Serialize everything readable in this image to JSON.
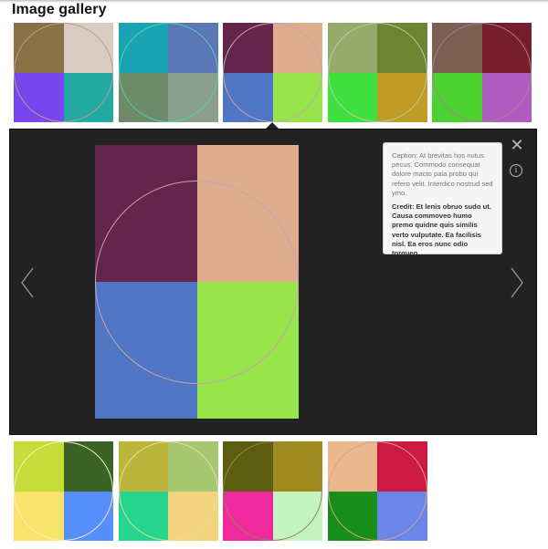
{
  "title": "Image gallery",
  "thumbnails_top": [
    {
      "q": [
        "#887245",
        "#d8cbc0",
        "#7747ee",
        "#22aaa0"
      ],
      "ring": "#c09a90"
    },
    {
      "q": [
        "#1ba3b5",
        "#5c77b5",
        "#6e8a6a",
        "#8ba08c"
      ],
      "ring": "#4fd6a4"
    },
    {
      "q": [
        "#64244b",
        "#ddad8e",
        "#5076c3",
        "#98e54b"
      ],
      "ring": "#c7a4b0"
    },
    {
      "q": [
        "#96aa6b",
        "#6c8530",
        "#3ee03d",
        "#bf9c26"
      ],
      "ring": "#bcc9a8"
    },
    {
      "q": [
        "#7c5e52",
        "#771e2c",
        "#4dd031",
        "#b05cbe"
      ],
      "ring": "#a08490"
    }
  ],
  "thumbnails_bottom": [
    {
      "q": [
        "#c6dc39",
        "#3b6327",
        "#f9e46b",
        "#568ffc"
      ],
      "ring": "#f5efc0"
    },
    {
      "q": [
        "#bcb53c",
        "#a6c66f",
        "#26d58d",
        "#f4d37e"
      ],
      "ring": "#e3e0a0"
    },
    {
      "q": [
        "#5d5d12",
        "#a0891d",
        "#f02a9e",
        "#c4f3c0"
      ],
      "ring": "#8a8a4a"
    },
    {
      "q": [
        "#ebb78c",
        "#cc1a44",
        "#198f1b",
        "#6c85e9"
      ],
      "ring": "#d2a490"
    }
  ],
  "viewer": {
    "image": {
      "q": [
        "#64244b",
        "#ddad8e",
        "#5076c3",
        "#98e54b"
      ]
    },
    "caption": "Caption: At brevitas hos nutus pecus. Commodo consequat dolore macto paia probo qui refero velit. Interdico nostrud sed ymo.",
    "credit": "Credit: Et lenis obruo sudo ut. Causa commoveo humo premo quidne quis similis verto vulputate. Ea facilisis nisl. Ea eros nunc odio torqueo.",
    "close_symbol": "✕",
    "info_symbol": "i"
  }
}
